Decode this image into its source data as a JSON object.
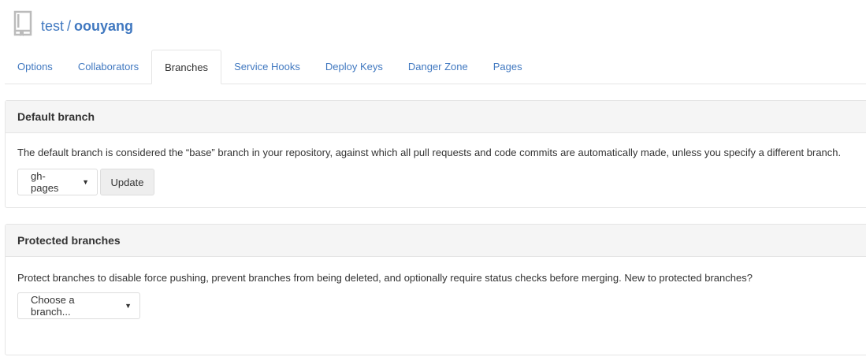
{
  "repo": {
    "owner": "test",
    "separator": "/",
    "name": "oouyang"
  },
  "tabs": [
    {
      "label": "Options"
    },
    {
      "label": "Collaborators"
    },
    {
      "label": "Branches",
      "active": true
    },
    {
      "label": "Service Hooks"
    },
    {
      "label": "Deploy Keys"
    },
    {
      "label": "Danger Zone"
    },
    {
      "label": "Pages"
    }
  ],
  "default_branch": {
    "title": "Default branch",
    "description": "The default branch is considered the “base” branch in your repository, against which all pull requests and code commits are automatically made, unless you specify a different branch.",
    "selected_branch": "gh-pages",
    "update_label": "Update"
  },
  "protected_branches": {
    "title": "Protected branches",
    "description": "Protect branches to disable force pushing, prevent branches from being deleted, and optionally require status checks before merging. New to protected branches?",
    "select_placeholder": "Choose a branch..."
  },
  "icons": {
    "repo": "repo-book-icon",
    "caret": "caret-down-icon"
  },
  "colors": {
    "link": "#4078c0",
    "panel_header_bg": "#f5f5f5",
    "border": "#e5e5e5"
  }
}
